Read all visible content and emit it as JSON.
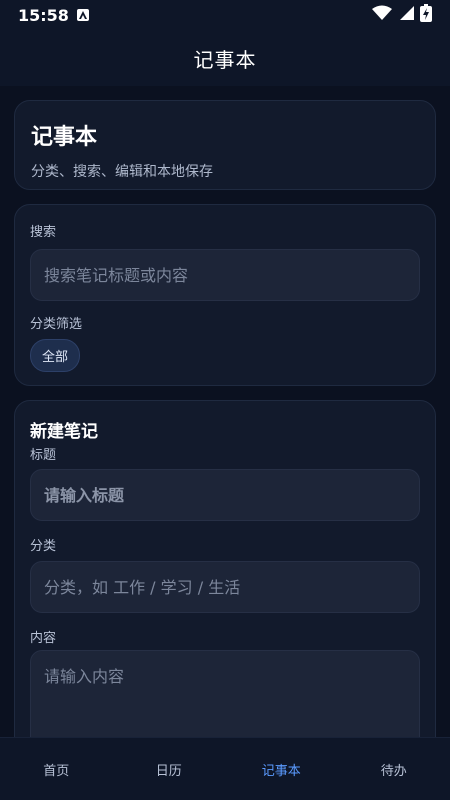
{
  "status": {
    "time": "15:58"
  },
  "header": {
    "title": "记事本"
  },
  "hero": {
    "title": "记事本",
    "subtitle": "分类、搜索、编辑和本地保存"
  },
  "search": {
    "label": "搜索",
    "placeholder": "搜索笔记标题或内容",
    "filter_label": "分类筛选",
    "chips": [
      "全部"
    ]
  },
  "new_note": {
    "title": "新建笔记",
    "title_label": "标题",
    "title_placeholder": "请输入标题",
    "category_label": "分类",
    "category_placeholder": "分类，如 工作 / 学习 / 生活",
    "content_label": "内容",
    "content_placeholder": "请输入内容"
  },
  "nav": {
    "items": [
      {
        "label": "首页"
      },
      {
        "label": "日历"
      },
      {
        "label": "记事本"
      },
      {
        "label": "待办"
      }
    ],
    "active_index": 2
  },
  "colors": {
    "background": "#0b1120",
    "card": "#121a2c",
    "accent": "#5b9bff"
  }
}
